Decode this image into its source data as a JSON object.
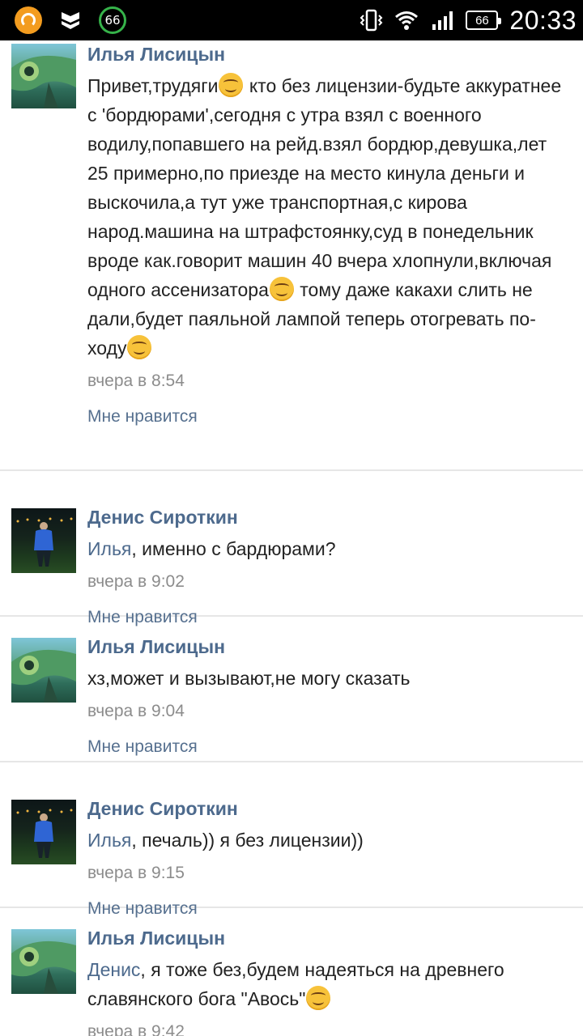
{
  "status_bar": {
    "notification_icons": [
      "app-circle-icon",
      "shield-icon",
      "battery-ring-icon"
    ],
    "battery_ring_value": "66",
    "battery_level": "66",
    "clock": "20:33"
  },
  "comments": [
    {
      "author": "Илья Лисицын",
      "avatar": "chameleon-avatar",
      "parts": [
        {
          "t": "Привет,трудяги"
        },
        {
          "e": "smile-emoji"
        },
        {
          "t": " кто без лицензии-будьте аккуратнее с 'бордюрами',сегодня с утра взял с военного водилу,попавшего на рейд.взял бордюр,девушка,лет 25 примерно,по приезде на место кинула деньги и выскочила,а тут уже транспортная,с кирова народ.машина на штрафстоянку,суд в понедельник вроде как.говорит машин 40 вчера хлопнули,включая одного ассенизатора"
        },
        {
          "e": "smile-emoji"
        },
        {
          "t": " тому даже какахи слить не дали,будет паяльной лампой теперь отогревать по-ходу"
        },
        {
          "e": "smile-emoji"
        }
      ],
      "time": "вчера в 8:54",
      "like_label": "Мне нравится"
    },
    {
      "author": "Денис Сироткин",
      "avatar": "night-photo-avatar",
      "parts": [
        {
          "m": "Илья"
        },
        {
          "t": ", именно с бардюрами?"
        }
      ],
      "time": "вчера в 9:02",
      "like_label": "Мне нравится"
    },
    {
      "author": "Илья Лисицын",
      "avatar": "chameleon-avatar",
      "parts": [
        {
          "t": "хз,может и вызывают,не могу сказать"
        }
      ],
      "time": "вчера в 9:04",
      "like_label": "Мне нравится"
    },
    {
      "author": "Денис Сироткин",
      "avatar": "night-photo-avatar",
      "parts": [
        {
          "m": "Илья"
        },
        {
          "t": ", печаль)) я без лицензии))"
        }
      ],
      "time": "вчера в 9:15",
      "like_label": "Мне нравится"
    },
    {
      "author": "Илья Лисицын",
      "avatar": "chameleon-avatar",
      "parts": [
        {
          "m": "Денис"
        },
        {
          "t": ", я тоже без,будем надеяться на древнего славянского бога \"Авось\""
        },
        {
          "e": "smile-emoji"
        }
      ],
      "time": "вчера в 9:42",
      "like_label": ""
    }
  ]
}
